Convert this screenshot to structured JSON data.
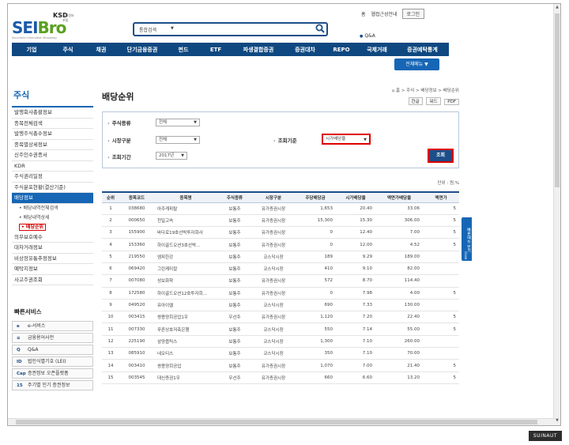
{
  "header": {
    "logo_ksd": "KSD",
    "logo_ksd_sub": "증권정보포털",
    "logo_brand_a": "SEI",
    "logo_brand_b": "Bro",
    "logo_tag": "Securities information Broadway",
    "search_select": "통합검색",
    "search_dropdown": "▼",
    "toplink_home": "홈",
    "toplink_guide": "웹접근성안내",
    "login_label": "로그인",
    "qna": "Q&A"
  },
  "gnb": [
    "기업",
    "주식",
    "채권",
    "단기금융증권",
    "펀드",
    "ETF",
    "파생결합증권",
    "증권대차",
    "REPO",
    "국제거래",
    "증권예탁통계"
  ],
  "allmenu": "전체메뉴 ▼",
  "sidebar": {
    "title": "주식",
    "items": [
      {
        "label": "발행회사총괄정보"
      },
      {
        "label": "종목전체검색"
      },
      {
        "label": "발행주식총수정보"
      },
      {
        "label": "종목별상세정보"
      },
      {
        "label": "신주인수권증서"
      },
      {
        "label": "KDR"
      },
      {
        "label": "주식권리일정"
      },
      {
        "label": "주식분포현황(결산기준)"
      },
      {
        "label": "배당정보"
      }
    ],
    "subitems": [
      {
        "label": "• 배당내역전체검색"
      },
      {
        "label": "• 배당내역상세"
      },
      {
        "label": "• 배당순위"
      }
    ],
    "items2": [
      {
        "label": "의무보호예수"
      },
      {
        "label": "대차거래정보"
      },
      {
        "label": "비상장유통추정정보"
      },
      {
        "label": "예탁지정보"
      },
      {
        "label": "사고주권조회"
      }
    ]
  },
  "quick": {
    "title": "빠른서비스",
    "items": [
      {
        "icon": "e",
        "label": "e-서비스"
      },
      {
        "icon": "≡",
        "label": "금융용어사전"
      },
      {
        "icon": "Q",
        "label": "Q&A"
      },
      {
        "icon": "ID",
        "label": "법인식별기호 (LEI)"
      },
      {
        "icon": "Cap",
        "label": "증권정보 오픈플랫폼"
      },
      {
        "icon": "15",
        "label": "주기별 인기 증권정보"
      }
    ]
  },
  "content": {
    "title": "배당순위",
    "breadcrumb": "⌂ 홈 > 주식 > 배당정보 > 배당순위",
    "util_hangul": "한글",
    "util_word": "워드",
    "util_pdf": "PDF",
    "filters": {
      "stock_type_label": "주식종류",
      "stock_type_value": "전체",
      "market_label": "시장구분",
      "market_value": "전체",
      "criteria_label": "조회기준",
      "criteria_value": "시가배당율",
      "period_label": "조회기간",
      "period_value": "2017년",
      "dropdown_arrow": "▼",
      "search_button": "조회"
    },
    "unit": "단위 : 원,%"
  },
  "table": {
    "headers": [
      "순위",
      "종목코드",
      "종목명",
      "주식종류",
      "시장구분",
      "주당배당금",
      "시가배당율",
      "액면가배당율",
      "액면가"
    ],
    "rows": [
      [
        "1",
        "038680",
        "아주캐피탈",
        "보통주",
        "유가증권시장",
        "1,653",
        "20.40",
        "33.06",
        "5"
      ],
      [
        "2",
        "000650",
        "천일고속",
        "보통주",
        "유가증권시장",
        "15,300",
        "15.30",
        "306.00",
        "5"
      ],
      [
        "3",
        "155900",
        "바다로19호선박투자회사",
        "보통주",
        "유가증권시장",
        "0",
        "12.40",
        "7.00",
        "5"
      ],
      [
        "4",
        "153360",
        "하이골드오션3호선박...",
        "보통주",
        "유가증권시장",
        "0",
        "12.00",
        "4.52",
        "5"
      ],
      [
        "5",
        "219550",
        "엠피한강",
        "보통주",
        "코스닥시장",
        "189",
        "9.29",
        "189.00",
        ""
      ],
      [
        "6",
        "069420",
        "그린케미칼",
        "보통주",
        "코스닥시장",
        "410",
        "9.10",
        "82.00",
        ""
      ],
      [
        "7",
        "007080",
        "성보화학",
        "보통주",
        "유가증권시장",
        "572",
        "8.70",
        "114.40",
        ""
      ],
      [
        "8",
        "172580",
        "하이골드오션12호투자회...",
        "보통주",
        "유가증권시장",
        "0",
        "7.98",
        "4.00",
        "5"
      ],
      [
        "9",
        "049520",
        "유아이엘",
        "보통주",
        "코스닥시장",
        "690",
        "7.33",
        "130.00",
        ""
      ],
      [
        "10",
        "003415",
        "쌍용양회공업1우",
        "우선주",
        "유가증권시장",
        "1,120",
        "7.20",
        "22.40",
        "5"
      ],
      [
        "11",
        "007330",
        "푸른상호저축은행",
        "보통주",
        "코스닥시장",
        "550",
        "7.14",
        "55.00",
        "5"
      ],
      [
        "12",
        "225190",
        "삼양옵틱스",
        "보통주",
        "코스닥시장",
        "1,300",
        "7.10",
        "260.00",
        ""
      ],
      [
        "13",
        "085910",
        "네오티스",
        "보통주",
        "코스닥시장",
        "350",
        "7.10",
        "70.00",
        ""
      ],
      [
        "14",
        "003410",
        "쌍용양회공업",
        "보통주",
        "유가증권시장",
        "1,070",
        "7.00",
        "21.40",
        "5"
      ],
      [
        "15",
        "003545",
        "대신증권1우",
        "우선주",
        "유가증권시장",
        "660",
        "6.60",
        "13.20",
        "5"
      ]
    ]
  },
  "float_tab": "빠른메뉴 닫기",
  "float_close": "close",
  "taskbar_label": "SUINAUT"
}
